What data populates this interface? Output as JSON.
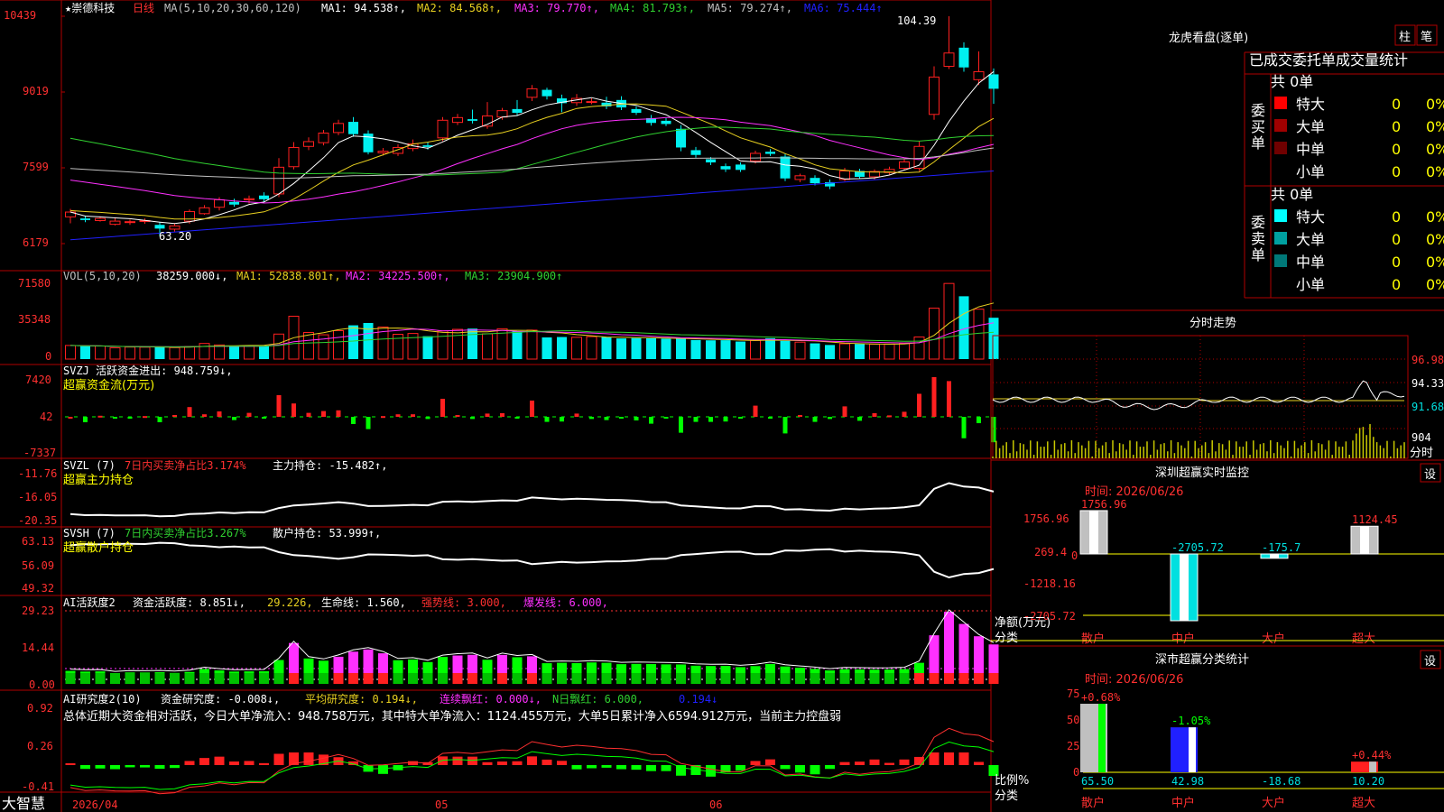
{
  "app": {
    "brand": "大智慧",
    "star_label": "★崇德科技",
    "period": "日线"
  },
  "colors": {
    "up": "#ff2020",
    "down": "#00f0f0",
    "ma1": "#ffffff",
    "ma2": "#e8d020",
    "ma3": "#ff30ff",
    "ma4": "#30d030",
    "ma5": "#c0c0c0",
    "ma6": "#2020ff",
    "grid": "#b00000"
  },
  "header": {
    "ma_prefix": "MA(5,10,20,30,60,120)",
    "ma1": "MA1: 94.538↑,",
    "ma2": "MA2: 84.568↑,",
    "ma3": "MA3: 79.770↑,",
    "ma4": "MA4: 81.793↑,",
    "ma5": "MA5: 79.274↑,",
    "ma6": "MA6: 75.444↑"
  },
  "price_axis": [
    "10439",
    "9019",
    "7599",
    "6179"
  ],
  "annotations": {
    "high": "104.39",
    "low": "63.20"
  },
  "vol": {
    "prefix": "VOL(5,10,20)",
    "v": "38259.000↓,",
    "ma1": "MA1: 52838.801↑,",
    "ma2": "MA2: 34225.500↑,",
    "ma3": "MA3: 23904.900↑",
    "axis": [
      "71580",
      "35348",
      "0"
    ]
  },
  "svzj": {
    "prefix": "SVZJ  活跃资金进出: 948.759↓,",
    "sub": "超赢资金流(万元)",
    "axis": [
      "7420",
      "42",
      "-7337"
    ]
  },
  "svzl": {
    "prefix": "SVZL (7)",
    "pct": "7日内买卖净占比3.174%",
    "hold": "主力持仓: -15.482↑,",
    "sub": "超赢主力持仓",
    "axis": [
      "-11.76",
      "-16.05",
      "-20.35"
    ]
  },
  "svsh": {
    "prefix": "SVSH (7)",
    "pct": "7日内买卖净占比3.267%",
    "hold": "散户持仓: 53.999↑,",
    "sub": "超赢散户持仓",
    "axis": [
      "63.13",
      "56.09",
      "49.32"
    ]
  },
  "ai2": {
    "prefix": "AI活跃度2",
    "act": "资金活跃度: 8.851↓,",
    "v2": "29.226,",
    "life": "生命线: 1.560,",
    "strong": "强势线: 3.000,",
    "burst": "爆发线: 6.000,",
    "axis": [
      "29.23",
      "14.44",
      "0.00"
    ]
  },
  "ai_res": {
    "prefix": "AI研究度2(10)",
    "res": "资金研究度: -0.008↓,",
    "avg": "平均研究度: 0.194↓,",
    "cont": "连续飘红: 0.000↓,",
    "nday": "N日飘红: 6.000,",
    "last": "0.194↓",
    "summary": "总体近期大资金相对活跃，今日大单净流入：948.758万元，其中特大单净流入：1124.455万元，大单5日累计净入6594.912万元，当前主力控盘弱",
    "axis": [
      "0.92",
      "0.26",
      "-0.41"
    ]
  },
  "date_axis": [
    "2026/04",
    "05",
    "06"
  ],
  "right": {
    "lhb_title": "龙虎看盘(逐单)",
    "btn_zhu": "柱",
    "btn_bi": "笔",
    "table_header": "已成交委托单成交量统计",
    "buy_label": "委买单",
    "sell_label": "委卖单",
    "total_buy": "共 0单",
    "total_sell": "共 0单",
    "buy_rows": [
      {
        "label": "特大",
        "count": "0",
        "pct": "0%",
        "color": "#ff0000"
      },
      {
        "label": "大单",
        "count": "0",
        "pct": "0%",
        "color": "#a00000"
      },
      {
        "label": "中单",
        "count": "0",
        "pct": "0%",
        "color": "#700000"
      },
      {
        "label": "小单",
        "count": "0",
        "pct": "0%",
        "color": "#000000"
      }
    ],
    "sell_rows": [
      {
        "label": "特大",
        "count": "0",
        "pct": "0%",
        "color": "#00ffff"
      },
      {
        "label": "大单",
        "count": "0",
        "pct": "0%",
        "color": "#00a0a0"
      },
      {
        "label": "中单",
        "count": "0",
        "pct": "0%",
        "color": "#007878"
      },
      {
        "label": "小单",
        "count": "0",
        "pct": "0%",
        "color": "#000000"
      }
    ],
    "intraday_title": "分时走势",
    "intraday_axis": [
      "96.98",
      "94.33",
      "91.68",
      "904",
      "分时"
    ],
    "monitor_title": "深圳超赢实时监控",
    "btn_set": "设",
    "monitor_time": "时间: 2026/06/26",
    "monitor_axis": [
      "1756.96",
      "269.4",
      "0",
      "-1218.16",
      "-2705.72"
    ],
    "monitor_ylabel": "净额(万元)",
    "monitor_xlabel": "分类",
    "monitor_values": [
      "1756.96",
      "-2705.72",
      "-175.7",
      "1124.45"
    ],
    "cats": [
      "散户",
      "中户",
      "大户",
      "超大"
    ],
    "stat_title": "深市超赢分类统计",
    "stat_time": "时间: 2026/06/26",
    "stat_axis": [
      "75",
      "50",
      "25",
      "0"
    ],
    "stat_pcts": [
      "+0.68%",
      "-1.05%",
      "",
      "+0.44%"
    ],
    "stat_vals": [
      "65.50",
      "42.98",
      "-18.68",
      "10.20"
    ],
    "stat_ylabel": "比例%",
    "stat_xlabel": "分类"
  },
  "chart_data": {
    "type": "candlestick",
    "title": "崇德科技 日线",
    "dates_labels": [
      "2026/04",
      "05",
      "06"
    ],
    "ylim": [
      61.79,
      104.39
    ],
    "candles": [
      [
        66.8,
        67.7,
        65.6,
        68.3
      ],
      [
        66.5,
        66.2,
        65.8,
        67.0
      ],
      [
        66.1,
        66.5,
        65.9,
        66.9
      ],
      [
        65.4,
        66.0,
        65.2,
        66.6
      ],
      [
        65.8,
        65.9,
        65.3,
        66.3
      ],
      [
        66.0,
        66.1,
        65.5,
        66.5
      ],
      [
        65.3,
        64.6,
        63.2,
        65.8
      ],
      [
        64.5,
        65.1,
        64.0,
        65.5
      ],
      [
        66.0,
        67.8,
        65.5,
        68.2
      ],
      [
        67.4,
        68.5,
        67.2,
        69.0
      ],
      [
        68.6,
        70.0,
        68.0,
        70.5
      ],
      [
        69.6,
        69.1,
        68.7,
        70.2
      ],
      [
        70.0,
        70.2,
        69.3,
        70.8
      ],
      [
        70.8,
        70.1,
        69.6,
        71.4
      ],
      [
        71.1,
        76.1,
        70.5,
        77.8
      ],
      [
        76.2,
        79.8,
        75.7,
        80.8
      ],
      [
        80.0,
        80.9,
        79.3,
        81.7
      ],
      [
        80.7,
        82.5,
        80.2,
        83.1
      ],
      [
        82.6,
        84.3,
        82.1,
        85.0
      ],
      [
        84.6,
        82.3,
        81.8,
        85.5
      ],
      [
        82.4,
        78.9,
        78.5,
        83.0
      ],
      [
        78.8,
        79.1,
        78.3,
        79.7
      ],
      [
        78.7,
        79.8,
        78.2,
        80.4
      ],
      [
        79.6,
        80.5,
        79.1,
        81.3
      ],
      [
        80.2,
        79.9,
        79.4,
        80.8
      ],
      [
        81.6,
        84.9,
        81.0,
        85.5
      ],
      [
        84.5,
        85.4,
        84.0,
        86.1
      ],
      [
        85.1,
        84.8,
        84.3,
        86.9
      ],
      [
        83.8,
        85.7,
        83.3,
        88.3
      ],
      [
        85.5,
        86.7,
        85.0,
        87.2
      ],
      [
        87.0,
        86.3,
        85.8,
        88.7
      ],
      [
        89.2,
        90.8,
        88.5,
        91.5
      ],
      [
        90.6,
        89.4,
        88.8,
        91.0
      ],
      [
        89.0,
        88.1,
        86.4,
        89.7
      ],
      [
        88.2,
        89.0,
        87.6,
        89.8
      ],
      [
        88.4,
        88.4,
        87.9,
        89.0
      ],
      [
        88.2,
        87.5,
        87.0,
        89.3
      ],
      [
        88.7,
        87.3,
        86.8,
        89.4
      ],
      [
        87.0,
        86.3,
        85.9,
        87.5
      ],
      [
        85.3,
        84.4,
        83.9,
        85.9
      ],
      [
        84.8,
        84.2,
        83.8,
        85.3
      ],
      [
        83.3,
        79.8,
        79.1,
        84.0
      ],
      [
        79.3,
        78.4,
        77.9,
        79.9
      ],
      [
        77.6,
        77.0,
        76.5,
        78.0
      ],
      [
        76.3,
        75.7,
        75.2,
        76.8
      ],
      [
        76.6,
        75.6,
        75.2,
        77.0
      ],
      [
        77.3,
        78.7,
        76.8,
        79.2
      ],
      [
        79.0,
        78.6,
        78.2,
        79.5
      ],
      [
        78.1,
        74.0,
        73.5,
        78.6
      ],
      [
        73.8,
        74.5,
        73.3,
        74.9
      ],
      [
        74.1,
        73.1,
        72.7,
        74.6
      ],
      [
        73.3,
        72.5,
        72.0,
        73.8
      ],
      [
        73.8,
        75.4,
        73.5,
        76.0
      ],
      [
        75.4,
        74.3,
        73.9,
        75.8
      ],
      [
        74.3,
        75.3,
        73.8,
        75.7
      ],
      [
        75.1,
        75.7,
        74.6,
        76.2
      ],
      [
        75.9,
        77.1,
        75.5,
        77.6
      ],
      [
        75.9,
        80.0,
        75.4,
        81.0
      ],
      [
        86.0,
        93.0,
        85.0,
        95.0
      ],
      [
        95.0,
        97.5,
        94.5,
        104.39
      ],
      [
        98.5,
        94.8,
        94.0,
        99.5
      ],
      [
        92.5,
        94.0,
        91.5,
        97.8
      ],
      [
        93.5,
        90.8,
        88.0,
        94.6
      ]
    ],
    "volumes": [
      13500,
      12800,
      13000,
      11200,
      11900,
      11800,
      12100,
      11400,
      12400,
      15500,
      14000,
      12800,
      13000,
      13100,
      24800,
      42500,
      26400,
      24100,
      28200,
      33500,
      35800,
      31800,
      24600,
      25400,
      22700,
      28000,
      29500,
      30200,
      25100,
      30100,
      27700,
      28700,
      21500,
      21900,
      21600,
      22300,
      21900,
      20500,
      20800,
      20600,
      20300,
      20200,
      18900,
      18600,
      18700,
      17400,
      18500,
      20700,
      18100,
      16800,
      15600,
      14000,
      15200,
      15000,
      14800,
      14900,
      15400,
      21900,
      50500,
      75000,
      62300,
      49500,
      41000
    ],
    "ma_lines": [
      "MA1",
      "MA2",
      "MA3",
      "MA4",
      "MA5",
      "MA6"
    ]
  }
}
